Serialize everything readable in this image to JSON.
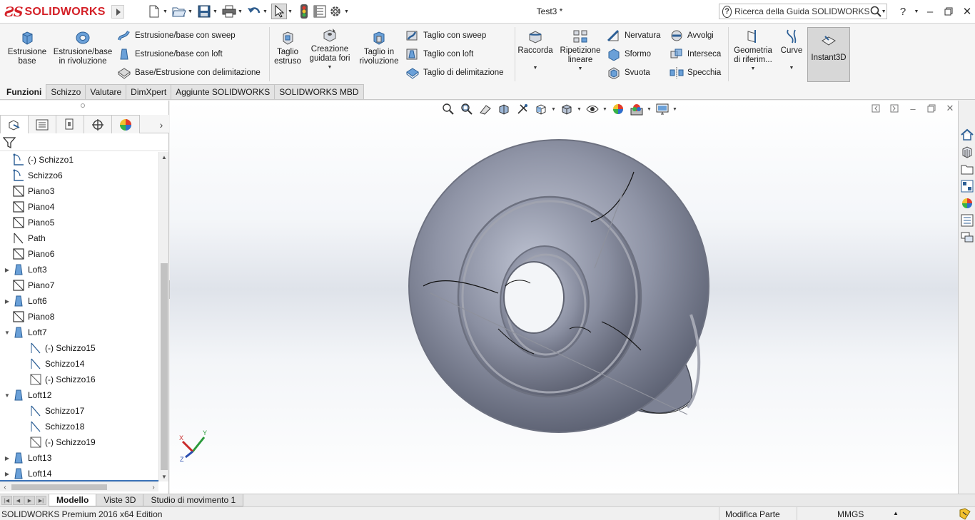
{
  "app": {
    "logo_text": "SOLIDWORKS",
    "document_title": "Test3 *",
    "search_placeholder": "Ricerca della Guida SOLIDWORKS"
  },
  "quick_access": [
    "new-document-icon",
    "open-icon",
    "save-icon",
    "print-icon",
    "undo-icon",
    "select-icon",
    "rebuild-traffic-light-icon",
    "file-properties-icon",
    "options-gear-icon"
  ],
  "command_manager": {
    "estrusione_base": "Estrusione\nbase",
    "estrusione_rivoluzione": "Estrusione/base\nin rivoluzione",
    "sweep": "Estrusione/base con sweep",
    "loft": "Estrusione/base con loft",
    "delimitazione": "Base/Estrusione con delimitazione",
    "taglio_estruso": "Taglio\nestruso",
    "creazione_fori": "Creazione\nguidata fori",
    "taglio_rivoluzione": "Taglio in\nrivoluzione",
    "taglio_sweep": "Taglio con sweep",
    "taglio_loft": "Taglio con loft",
    "taglio_delimitazione": "Taglio di delimitazione",
    "raccorda": "Raccorda",
    "ripetizione": "Ripetizione\nlineare",
    "nervatura": "Nervatura",
    "sformo": "Sformo",
    "svuota": "Svuota",
    "avvolgi": "Avvolgi",
    "interseca": "Interseca",
    "specchia": "Specchia",
    "geometria": "Geometria\ndi riferim...",
    "curve": "Curve",
    "instant3d": "Instant3D"
  },
  "tabs": [
    "Funzioni",
    "Schizzo",
    "Valutare",
    "DimXpert",
    "Aggiunte SOLIDWORKS",
    "SOLIDWORKS MBD"
  ],
  "active_tab": "Funzioni",
  "feature_tree": [
    {
      "label": "(-) Schizzo1",
      "icon": "sketch-icon",
      "indent": 0,
      "expander": ""
    },
    {
      "label": "Schizzo6",
      "icon": "sketch-icon",
      "indent": 0,
      "expander": ""
    },
    {
      "label": "Piano3",
      "icon": "plane-icon",
      "indent": 0,
      "expander": ""
    },
    {
      "label": "Piano4",
      "icon": "plane-icon",
      "indent": 0,
      "expander": ""
    },
    {
      "label": "Piano5",
      "icon": "plane-icon",
      "indent": 0,
      "expander": ""
    },
    {
      "label": "Path",
      "icon": "path-icon",
      "indent": 0,
      "expander": ""
    },
    {
      "label": "Piano6",
      "icon": "plane-icon",
      "indent": 0,
      "expander": ""
    },
    {
      "label": "Loft3",
      "icon": "loft-icon",
      "indent": 0,
      "expander": "collapsed"
    },
    {
      "label": "Piano7",
      "icon": "plane-icon",
      "indent": 0,
      "expander": ""
    },
    {
      "label": "Loft6",
      "icon": "loft-icon",
      "indent": 0,
      "expander": "collapsed"
    },
    {
      "label": "Piano8",
      "icon": "plane-icon",
      "indent": 0,
      "expander": ""
    },
    {
      "label": "Loft7",
      "icon": "loft-icon",
      "indent": 0,
      "expander": "expanded"
    },
    {
      "label": "(-) Schizzo15",
      "icon": "sketch-line-icon",
      "indent": 1,
      "expander": ""
    },
    {
      "label": "Schizzo14",
      "icon": "sketch-line-icon",
      "indent": 1,
      "expander": ""
    },
    {
      "label": "(-) Schizzo16",
      "icon": "sketch-box-icon",
      "indent": 1,
      "expander": ""
    },
    {
      "label": "Loft12",
      "icon": "loft-icon",
      "indent": 0,
      "expander": "expanded"
    },
    {
      "label": "Schizzo17",
      "icon": "sketch-line-icon",
      "indent": 1,
      "expander": ""
    },
    {
      "label": "Schizzo18",
      "icon": "sketch-line-icon",
      "indent": 1,
      "expander": ""
    },
    {
      "label": "(-) Schizzo19",
      "icon": "sketch-box-icon",
      "indent": 1,
      "expander": ""
    },
    {
      "label": "Loft13",
      "icon": "loft-icon",
      "indent": 0,
      "expander": "collapsed"
    },
    {
      "label": "Loft14",
      "icon": "loft-icon",
      "indent": 0,
      "expander": "collapsed"
    }
  ],
  "triad": {
    "x": "X",
    "y": "Y",
    "z": "Z"
  },
  "bottom_tabs": [
    "Modello",
    "Viste 3D",
    "Studio di movimento 1"
  ],
  "active_bottom_tab": "Modello",
  "status": {
    "edition": "SOLIDWORKS Premium 2016 x64 Edition",
    "mode": "Modifica Parte",
    "units": "MMGS"
  },
  "colors": {
    "brand_red": "#d42027",
    "model_gray": "#8f94a6",
    "accent_blue": "#3b73b9",
    "instant3d_active": "#d7d7d7"
  }
}
